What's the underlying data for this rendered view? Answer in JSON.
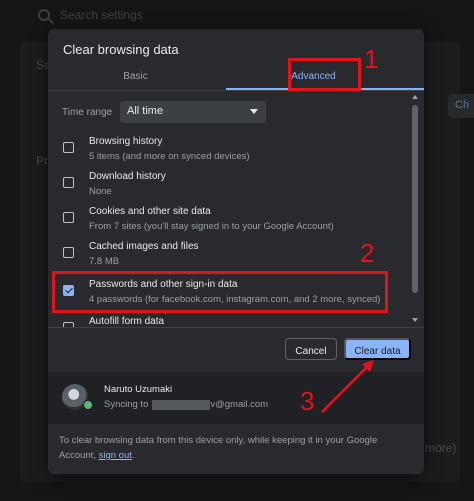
{
  "background": {
    "search_placeholder": "Search settings",
    "frag_sa": "Sa",
    "frag_pri": "Pri",
    "frag_ch": "Ch",
    "frag_more": "more)"
  },
  "dialog": {
    "title": "Clear browsing data",
    "tabs": [
      {
        "label": "Basic",
        "selected": false
      },
      {
        "label": "Advanced",
        "selected": true
      }
    ],
    "time_range": {
      "label": "Time range",
      "value": "All time"
    },
    "items": [
      {
        "title": "Browsing history",
        "subtitle": "5 items (and more on synced devices)",
        "checked": false
      },
      {
        "title": "Download history",
        "subtitle": "None",
        "checked": false
      },
      {
        "title": "Cookies and other site data",
        "subtitle": "From 7 sites (you'll stay signed in to your Google Account)",
        "checked": false
      },
      {
        "title": "Cached images and files",
        "subtitle": "7.8 MB",
        "checked": false
      },
      {
        "title": "Passwords and other sign-in data",
        "subtitle": "4 passwords (for facebook.com, instagram.com, and 2 more, synced)",
        "checked": true
      },
      {
        "title": "Autofill form data",
        "subtitle": "",
        "checked": false
      }
    ],
    "buttons": {
      "cancel": "Cancel",
      "clear": "Clear data"
    },
    "account": {
      "name": "Naruto Uzumaki",
      "sync_prefix": "Syncing to",
      "email_suffix": "v@gmail.com"
    },
    "footer": {
      "text": "To clear browsing data from this device only, while keeping it in your Google Account,",
      "link": "sign out",
      "end": "."
    }
  },
  "annotations": {
    "step1": "1",
    "step2": "2",
    "step3": "3",
    "color": "#e2131d"
  },
  "colors": {
    "accent": "#8ab4f8",
    "dialog_bg": "#292a2d"
  }
}
